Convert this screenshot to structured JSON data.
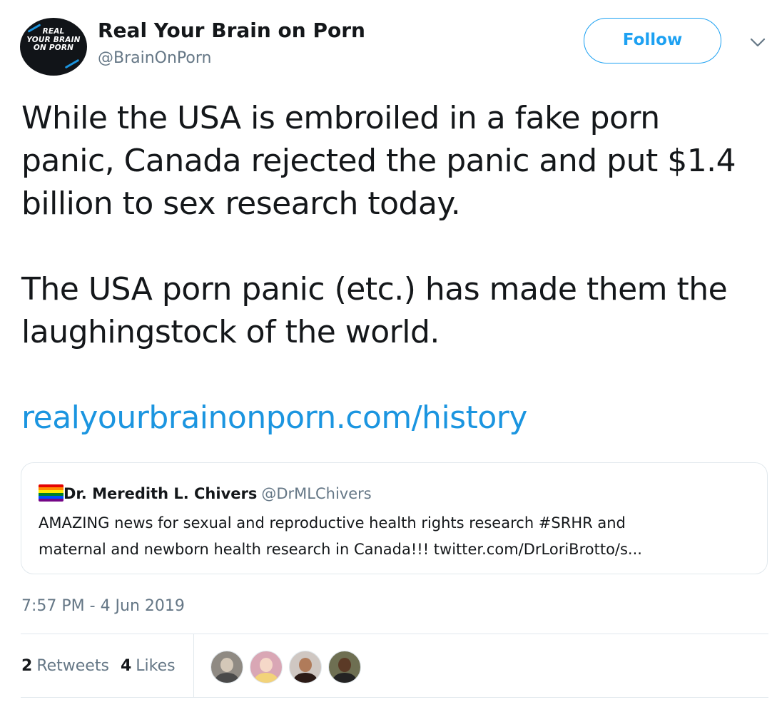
{
  "author": {
    "avatar_text": "REAL YOUR BRAIN ON PORN",
    "avatar_lines": [
      "REAL",
      "YOUR BRAIN",
      "ON PORN"
    ],
    "name": "Real Your Brain on Porn",
    "handle": "@BrainOnPorn"
  },
  "actions": {
    "follow_label": "Follow",
    "more_icon": "chevron-down-icon"
  },
  "tweet": {
    "text_lines": [
      "While the USA is embroiled in a fake porn",
      "panic, Canada rejected the panic and put $1.4",
      "billion to sex research today.",
      "",
      "The USA porn panic (etc.) has made them the",
      "laughingstock of the world."
    ],
    "link": "realyourbrainonporn.com/history"
  },
  "quote": {
    "flag_icon": "rainbow-flag-icon",
    "name": "Dr. Meredith L. Chivers",
    "handle": "@DrMLChivers",
    "body_lines": [
      "AMAZING news for sexual and reproductive health rights research #SRHR and",
      "maternal and newborn health research in Canada!!! twitter.com/DrLoriBrotto/s..."
    ]
  },
  "timestamp": "7:57 PM - 4 Jun 2019",
  "stats": {
    "retweets_count": "2",
    "retweets_label": "Retweets",
    "likes_count": "4",
    "likes_label": "Likes"
  },
  "colors": {
    "accent": "#1da1f2",
    "link": "#1b95e0",
    "text": "#14171a",
    "secondary_text": "#657786",
    "border": "#e1e8ed"
  }
}
